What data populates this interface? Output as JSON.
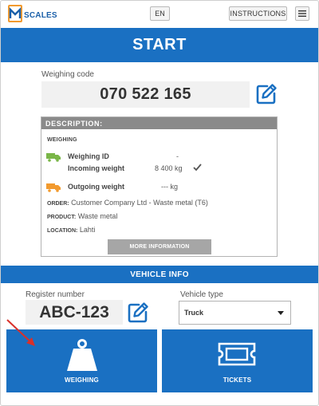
{
  "header": {
    "logo_text": "SCALES",
    "language_label": "EN",
    "instructions_label": "INSTRUCTIONS",
    "menu_icon": "hamburger-icon"
  },
  "start": {
    "title": "START"
  },
  "weighing_code": {
    "label": "Weighing code",
    "value": "070 522 165"
  },
  "description": {
    "header": "DESCRIPTION:",
    "section_title": "WEIGHING",
    "weighing_id_label": "Weighing ID",
    "weighing_id_value": "-",
    "incoming_weight_label": "Incoming weight",
    "incoming_weight_value": "8 400 kg",
    "outgoing_weight_label": "Outgoing weight",
    "outgoing_weight_value": "--- kg",
    "order_key": "ORDER:",
    "order_value": "Customer Company Ltd - Waste metal (T6)",
    "product_key": "PRODUCT:",
    "product_value": "Waste metal",
    "location_key": "LOCATION:",
    "location_value": "Lahti",
    "more_button": "MORE INFORMATION"
  },
  "vehicle": {
    "title": "VEHICLE INFO",
    "register_label": "Register number",
    "register_value": "ABC-123",
    "type_label": "Vehicle type",
    "type_value": "Truck"
  },
  "tiles": {
    "weighing_label": "WEIGHING",
    "tickets_label": "TICKETS"
  },
  "colors": {
    "primary_blue": "#1a70c2",
    "truck_green": "#7ab648",
    "truck_orange": "#f29a2e",
    "annotation_red": "#d9302a"
  }
}
